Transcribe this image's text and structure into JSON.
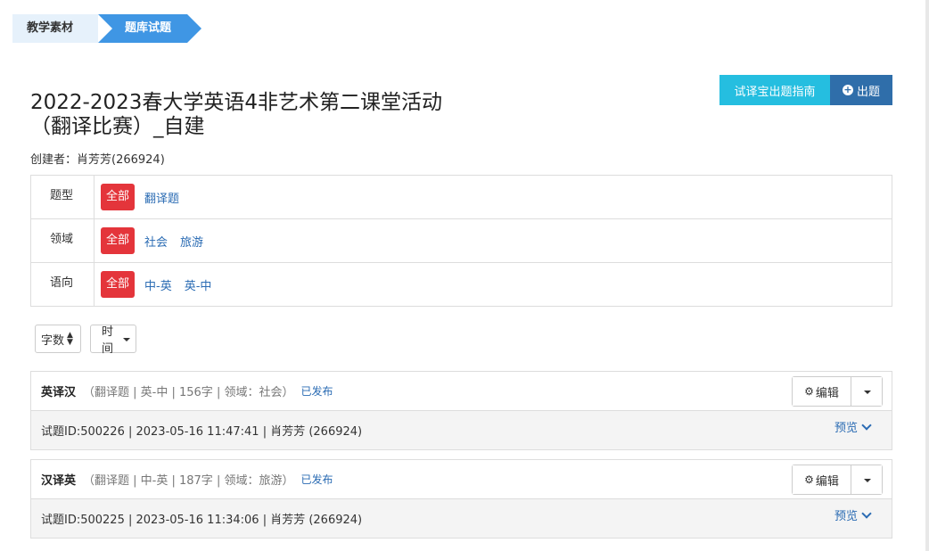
{
  "breadcrumb": {
    "steps": [
      {
        "label": "教学素材"
      },
      {
        "label": "题库试题"
      }
    ]
  },
  "toolbar": {
    "guide_label": "试译宝出题指南",
    "create_label": "出题"
  },
  "header": {
    "title": "2022-2023春大学英语4非艺术第二课堂活动（翻译比赛）_自建",
    "creator": "创建者：肖芳芳(266924)"
  },
  "filters": [
    {
      "label": "题型",
      "all": "全部",
      "options": [
        "翻译题"
      ]
    },
    {
      "label": "领域",
      "all": "全部",
      "options": [
        "社会",
        "旅游"
      ]
    },
    {
      "label": "语向",
      "all": "全部",
      "options": [
        "中-英",
        "英-中"
      ]
    }
  ],
  "sort": {
    "words_label": "字数",
    "time_label": "时间"
  },
  "questions": [
    {
      "type": "英译汉",
      "meta": "（翻译题 | 英-中 | 156字 | 领域：社会）",
      "status": "已发布",
      "edit_label": "编辑",
      "info": "试题ID:500226 | 2023-05-16 11:47:41 | 肖芳芳 (266924)",
      "preview_label": "预览"
    },
    {
      "type": "汉译英",
      "meta": "（翻译题 | 中-英 | 187字 | 领域：旅游）",
      "status": "已发布",
      "edit_label": "编辑",
      "info": "试题ID:500225 | 2023-05-16 11:34:06 | 肖芳芳 (266924)",
      "preview_label": "预览"
    }
  ],
  "colors": {
    "accent_blue": "#3f96e4",
    "guide_button": "#25bee0",
    "create_button": "#2f6eaa",
    "tag_red": "#e4353b",
    "link_blue": "#2a6bb3"
  }
}
